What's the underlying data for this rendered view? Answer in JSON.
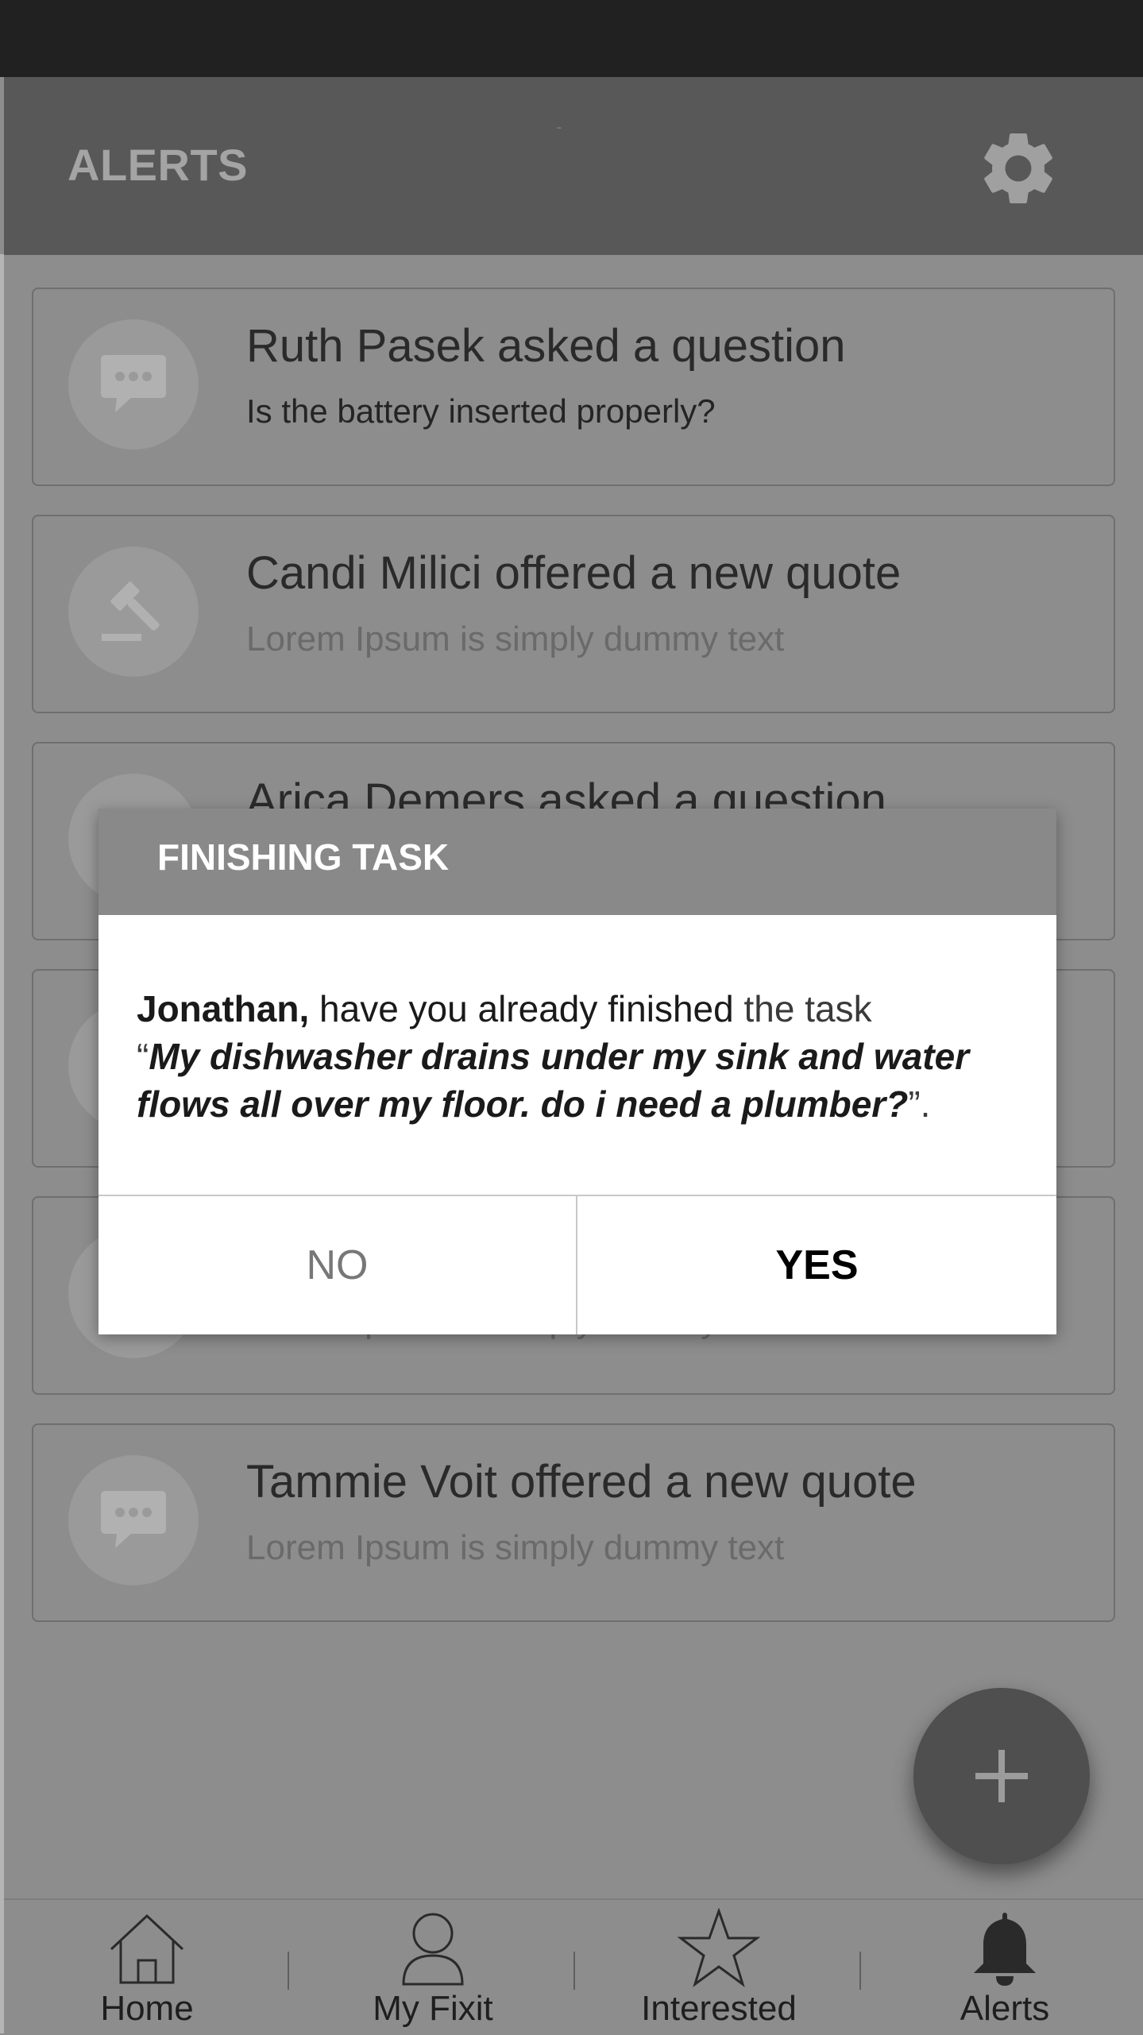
{
  "app_bar": {
    "title": "ALERTS",
    "dash": "-",
    "settings_icon": "gear-icon"
  },
  "alerts": [
    {
      "title": "Ruth Pasek asked a question",
      "subtitle": "Is the battery inserted properly?",
      "icon": "chat-bubble-icon"
    },
    {
      "title": "Candi Milici offered a new quote",
      "subtitle": "Lorem Ipsum is simply dummy text",
      "icon": "gavel-icon"
    },
    {
      "title": "Arica Demers asked a question",
      "subtitle": "",
      "icon": "chat-bubble-icon"
    },
    {
      "title": "",
      "subtitle": "",
      "icon": "chat-bubble-icon"
    },
    {
      "title": "",
      "subtitle": "Lorem Ipsum is simply dummy text",
      "icon": "chat-bubble-icon"
    },
    {
      "title": "Tammie Voit offered a new quote",
      "subtitle": "Lorem Ipsum is simply dummy text",
      "icon": "chat-bubble-icon"
    }
  ],
  "fab": {
    "icon": "plus-icon"
  },
  "bottom_nav": [
    {
      "label": "Home",
      "icon": "home-icon"
    },
    {
      "label": "My Fixit",
      "icon": "person-icon"
    },
    {
      "label": "Interested",
      "icon": "star-icon"
    },
    {
      "label": "Alerts",
      "icon": "bell-icon",
      "active": true
    }
  ],
  "dialog": {
    "title": "FINISHING TASK",
    "name": "Jonathan,",
    "question": " have you already finished",
    "the_task": " the task",
    "open_quote": "“",
    "task_text": "My dishwasher drains under my sink and water flows all over my floor. do i need a plumber?",
    "close_quote": "”.",
    "no_label": "NO",
    "yes_label": "YES"
  }
}
